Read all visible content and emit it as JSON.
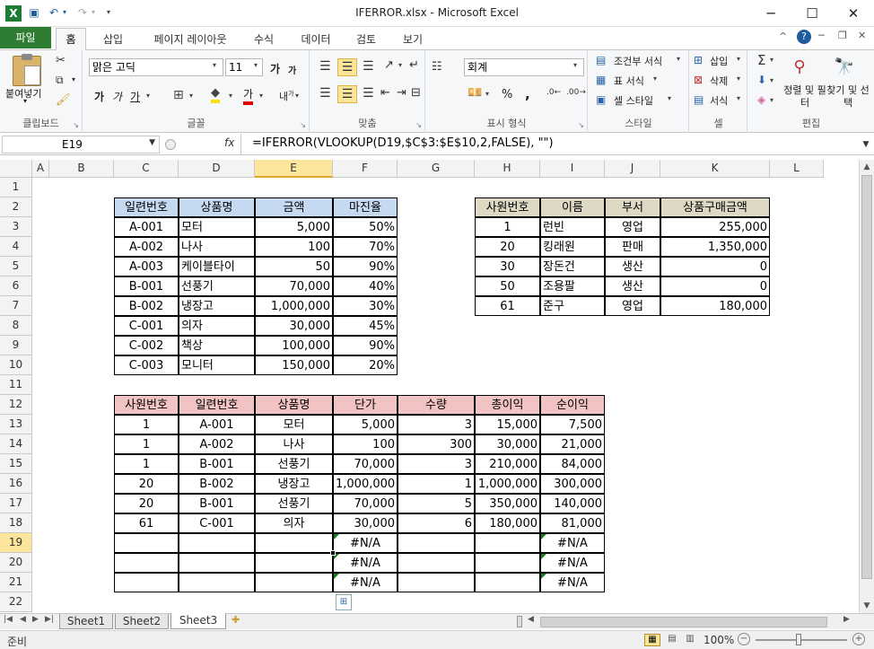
{
  "app": {
    "title": "IFERROR.xlsx  -  Microsoft Excel",
    "minimize": "─",
    "restore": "☐",
    "close": "✕"
  },
  "ribbon_tabs": [
    "파일",
    "홈",
    "삽입",
    "페이지 레이아웃",
    "수식",
    "데이터",
    "검토",
    "보기"
  ],
  "ribbon": {
    "paste": "붙여넣기",
    "font_name": "맑은 고딕",
    "font_size": "11",
    "number_format": "회계",
    "bold": "가",
    "italic": "가",
    "underline": "가",
    "grow": "가",
    "shrink": "가",
    "fontcolor": "가",
    "cond_format": "조건부 서식",
    "table_format": "표 서식",
    "cell_style": "셀 스타일",
    "insert": "삽입",
    "delete": "삭제",
    "format": "서식",
    "sort": "정렬 및 필터",
    "find": "찾기 및 선택",
    "percent": "%",
    "comma": ",",
    "groups": {
      "clipboard": "클립보드",
      "font": "글꼴",
      "align": "맞춤",
      "number": "표시 형식",
      "style": "스타일",
      "cells": "셀",
      "edit": "편집"
    }
  },
  "formula_bar": {
    "name_box": "E19",
    "fx": "fx",
    "formula": "=IFERROR(VLOOKUP(D19,$C$3:$E$10,2,FALSE), \"\")"
  },
  "columns": [
    "A",
    "B",
    "C",
    "D",
    "E",
    "F",
    "G",
    "H",
    "I",
    "J",
    "K",
    "L"
  ],
  "rows": [
    "1",
    "2",
    "3",
    "4",
    "5",
    "6",
    "7",
    "8",
    "9",
    "10",
    "11",
    "12",
    "13",
    "14",
    "15",
    "16",
    "17",
    "18",
    "19",
    "20",
    "21",
    "22"
  ],
  "product_table": {
    "headers": [
      "일련번호",
      "상품명",
      "금액",
      "마진율"
    ],
    "rows": [
      [
        "A-001",
        "모터",
        "5,000",
        "50%"
      ],
      [
        "A-002",
        "나사",
        "100",
        "70%"
      ],
      [
        "A-003",
        "케이블타이",
        "50",
        "90%"
      ],
      [
        "B-001",
        "선풍기",
        "70,000",
        "40%"
      ],
      [
        "B-002",
        "냉장고",
        "1,000,000",
        "30%"
      ],
      [
        "C-001",
        "의자",
        "30,000",
        "45%"
      ],
      [
        "C-002",
        "책상",
        "100,000",
        "90%"
      ],
      [
        "C-003",
        "모니터",
        "150,000",
        "20%"
      ]
    ]
  },
  "employee_table": {
    "headers": [
      "사원번호",
      "이름",
      "부서",
      "상품구매금액"
    ],
    "rows": [
      [
        "1",
        "런빈",
        "영업",
        "255,000"
      ],
      [
        "20",
        "킹래원",
        "판매",
        "1,350,000"
      ],
      [
        "30",
        "장돈건",
        "생산",
        "0"
      ],
      [
        "50",
        "조용팔",
        "생산",
        "0"
      ],
      [
        "61",
        "준구",
        "영업",
        "180,000"
      ]
    ]
  },
  "sales_table": {
    "headers": [
      "사원번호",
      "일련번호",
      "상품명",
      "단가",
      "수량",
      "총이익",
      "순이익"
    ],
    "rows": [
      [
        "1",
        "A-001",
        "모터",
        "5,000",
        "3",
        "15,000",
        "7,500"
      ],
      [
        "1",
        "A-002",
        "나사",
        "100",
        "300",
        "30,000",
        "21,000"
      ],
      [
        "1",
        "B-001",
        "선풍기",
        "70,000",
        "3",
        "210,000",
        "84,000"
      ],
      [
        "20",
        "B-002",
        "냉장고",
        "1,000,000",
        "1",
        "1,000,000",
        "300,000"
      ],
      [
        "20",
        "B-001",
        "선풍기",
        "70,000",
        "5",
        "350,000",
        "140,000"
      ],
      [
        "61",
        "C-001",
        "의자",
        "30,000",
        "6",
        "180,000",
        "81,000"
      ],
      [
        "",
        "",
        "",
        "#N/A",
        "",
        "",
        "#N/A"
      ],
      [
        "",
        "",
        "",
        "#N/A",
        "",
        "",
        "#N/A"
      ],
      [
        "",
        "",
        "",
        "#N/A",
        "",
        "",
        "#N/A"
      ]
    ]
  },
  "sheets": [
    "Sheet1",
    "Sheet2",
    "Sheet3"
  ],
  "status": {
    "ready": "준비",
    "zoom": "100%"
  }
}
